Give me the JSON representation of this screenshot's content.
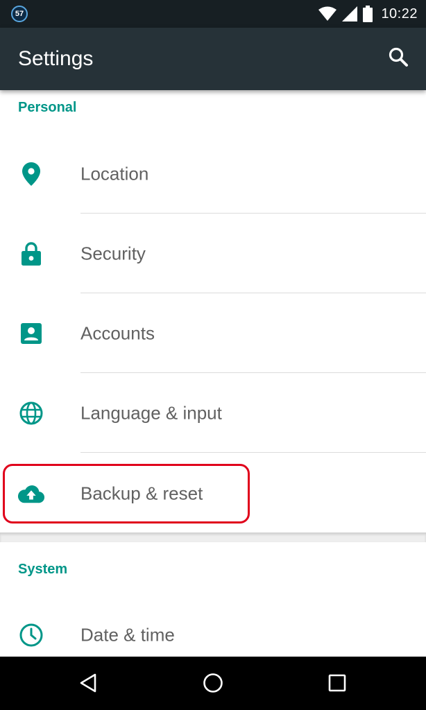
{
  "status_bar": {
    "notification_count": "57",
    "time": "10:22",
    "icons": [
      "wifi-icon",
      "signal-icon",
      "battery-icon"
    ]
  },
  "app_bar": {
    "title": "Settings",
    "search_icon": "search-icon"
  },
  "sections": {
    "personal": {
      "header": "Personal",
      "items": [
        {
          "label": "Location",
          "icon": "location-pin-icon"
        },
        {
          "label": "Security",
          "icon": "lock-icon"
        },
        {
          "label": "Accounts",
          "icon": "account-box-icon"
        },
        {
          "label": "Language & input",
          "icon": "globe-icon"
        },
        {
          "label": "Backup & reset",
          "icon": "cloud-upload-icon",
          "highlighted": true
        }
      ]
    },
    "system": {
      "header": "System",
      "items": [
        {
          "label": "Date & time",
          "icon": "clock-icon"
        }
      ]
    }
  },
  "nav_bar": {
    "back": "back-icon",
    "home": "home-icon",
    "recents": "recents-icon"
  },
  "colors": {
    "accent": "#009688",
    "app_bar": "#263238",
    "status_bar": "#171f23",
    "highlight": "#e0001b"
  }
}
